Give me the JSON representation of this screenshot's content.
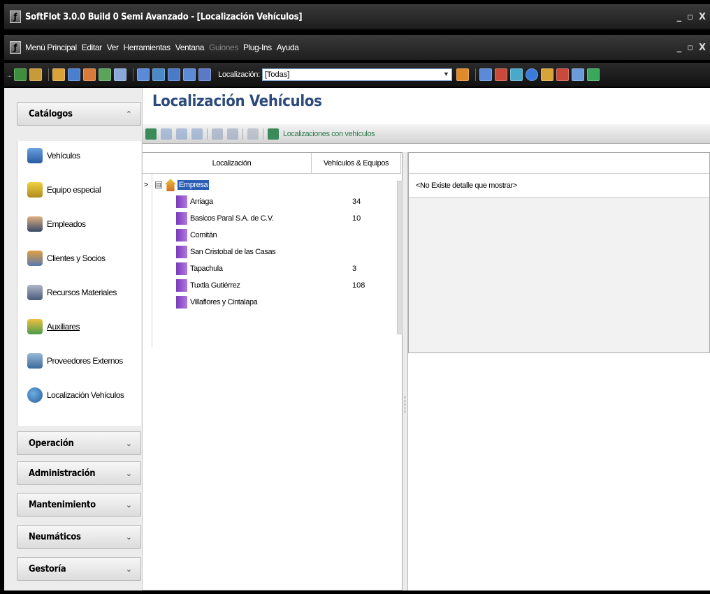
{
  "window": {
    "title": "SoftFlot 3.0.0 Build 0 Semi Avanzado - [Localización Vehículos]",
    "icon": "softflot-app-icon",
    "controls": [
      "_",
      "▫",
      "X"
    ]
  },
  "menubar": {
    "items": [
      "Menú Principal",
      "Editar",
      "Ver",
      "Herramientas",
      "Ventana",
      "Guiones",
      "Plug-Ins",
      "Ayuda"
    ],
    "disabled": [
      "Guiones"
    ],
    "controls": [
      "_",
      "▫",
      "X"
    ]
  },
  "toolbar": {
    "grip": "...",
    "localizacion_label": "Localización:",
    "localizacion_value": "[Todas]"
  },
  "sidebar": {
    "catalogos": {
      "label": "Catálogos",
      "chevron": "⌃",
      "items": [
        {
          "label": "Vehículos",
          "icon": "truck-icon"
        },
        {
          "label": "Equipo especial",
          "icon": "tools-icon"
        },
        {
          "label": "Empleados",
          "icon": "employee-icon"
        },
        {
          "label": "Clientes y Socios",
          "icon": "clients-icon"
        },
        {
          "label": "Recursos Materiales",
          "icon": "materials-icon"
        },
        {
          "label": "Auxiliares",
          "icon": "auxiliares-icon"
        },
        {
          "label": "Proveedores Externos",
          "icon": "suppliers-icon"
        },
        {
          "label": "Localización Vehículos",
          "icon": "location-icon"
        }
      ]
    },
    "groups": [
      {
        "label": "Operación",
        "chevron": "⌄"
      },
      {
        "label": "Administración",
        "chevron": "⌄"
      },
      {
        "label": "Mantenimiento",
        "chevron": "⌄"
      },
      {
        "label": "Neumáticos",
        "chevron": "⌄"
      },
      {
        "label": "Gestoría",
        "chevron": "⌄"
      }
    ]
  },
  "content": {
    "title": "Localización Vehículos",
    "subtoolbar_label": "Localizaciones con vehículos",
    "grid": {
      "columns": [
        "Localización",
        "Vehículos & Equipos"
      ],
      "root": {
        "name": "Empresa",
        "expander": "⊟"
      },
      "rows": [
        {
          "name": "Arriaga",
          "value": "34"
        },
        {
          "name": "Basicos Paral S.A. de C.V.",
          "value": "10"
        },
        {
          "name": "Comitán",
          "value": ""
        },
        {
          "name": "San Cristobal de las Casas",
          "value": ""
        },
        {
          "name": "Tapachula",
          "value": "3"
        },
        {
          "name": "Tuxtla Gutiérrez",
          "value": "108"
        },
        {
          "name": "Villaflores y Cintalapa",
          "value": ""
        }
      ]
    },
    "detail_message": "<No Existe detalle que mostrar>"
  },
  "colors": {
    "title_blue": "#2c4a7c",
    "selection": "#2b5fb6",
    "subtoolbar_label": "#2e7c4e"
  }
}
